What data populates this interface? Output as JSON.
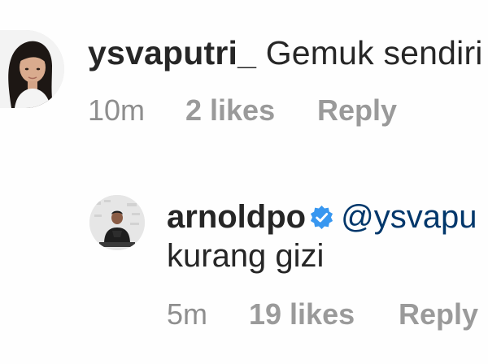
{
  "comments": [
    {
      "username": "ysvaputri_",
      "text": "Gemuk sendiri",
      "time": "10m",
      "likes": "2 likes",
      "reply_label": "Reply",
      "avatar_icon": "profile-photo-girl"
    },
    {
      "username": "arnoldpo",
      "verified_icon": "verified-badge-icon",
      "mention": "@ysvapu",
      "text": "kurang gizi",
      "time": "5m",
      "likes": "19 likes",
      "reply_label": "Reply",
      "avatar_icon": "profile-photo-man"
    }
  ],
  "colors": {
    "text": "#262626",
    "meta": "#8e8e8e",
    "mention": "#00376b",
    "verified": "#3897f0"
  }
}
